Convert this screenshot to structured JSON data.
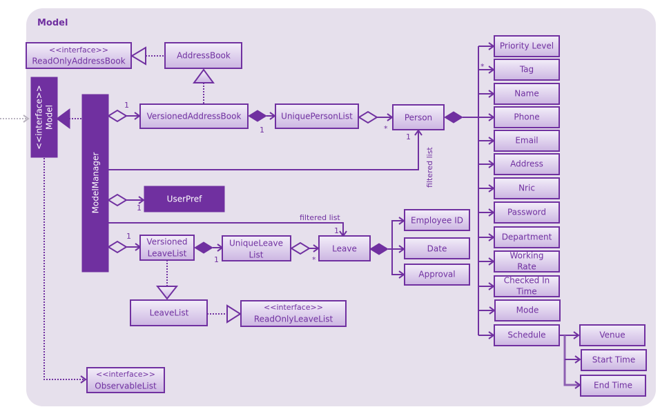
{
  "package": {
    "title": "Model"
  },
  "classes": {
    "read_only_address_book": {
      "stereotype": "<<interface>>",
      "name": "ReadOnlyAddressBook"
    },
    "address_book": {
      "name": "AddressBook"
    },
    "model": {
      "stereotype": "<<interface>>",
      "name": "Model"
    },
    "model_manager": {
      "name": "ModelManager"
    },
    "versioned_address_book": {
      "name": "VersionedAddressBook"
    },
    "unique_person_list": {
      "name": "UniquePersonList"
    },
    "person": {
      "name": "Person"
    },
    "user_pref": {
      "name": "UserPref"
    },
    "versioned_leave_list": {
      "line1": "Versioned",
      "line2": "LeaveList"
    },
    "unique_leave_list": {
      "line1": "UniqueLeave",
      "line2": "List"
    },
    "leave": {
      "name": "Leave"
    },
    "leave_list": {
      "name": "LeaveList"
    },
    "read_only_leave_list": {
      "stereotype": "<<interface>>",
      "name": "ReadOnlyLeaveList"
    },
    "observable_list": {
      "stereotype": "<<interface>>",
      "name": "ObservableList"
    },
    "employee_id": {
      "name": "Employee ID"
    },
    "date": {
      "name": "Date"
    },
    "approval": {
      "name": "Approval"
    },
    "priority_level": {
      "name": "Priority Level"
    },
    "tag": {
      "name": "Tag"
    },
    "name": {
      "name": "Name"
    },
    "phone": {
      "name": "Phone"
    },
    "email": {
      "name": "Email"
    },
    "address": {
      "name": "Address"
    },
    "nric": {
      "name": "Nric"
    },
    "password": {
      "name": "Password"
    },
    "department": {
      "name": "Department"
    },
    "working_rate": {
      "line1": "Working",
      "line2": "Rate"
    },
    "checked_in_time": {
      "line1": "Checked  In",
      "line2": "Time"
    },
    "mode": {
      "name": "Mode"
    },
    "schedule": {
      "name": "Schedule"
    },
    "venue": {
      "name": "Venue"
    },
    "start_time": {
      "name": "Start Time"
    },
    "end_time": {
      "name": "End Time"
    }
  },
  "labels": {
    "mult_one": "1",
    "mult_many": "*",
    "filtered_list": "filtered list"
  },
  "colors": {
    "accent": "#7030a0",
    "background": "#e6e0ec",
    "box_top": "#f2ecf8",
    "box_bottom": "#cdb5e3"
  }
}
